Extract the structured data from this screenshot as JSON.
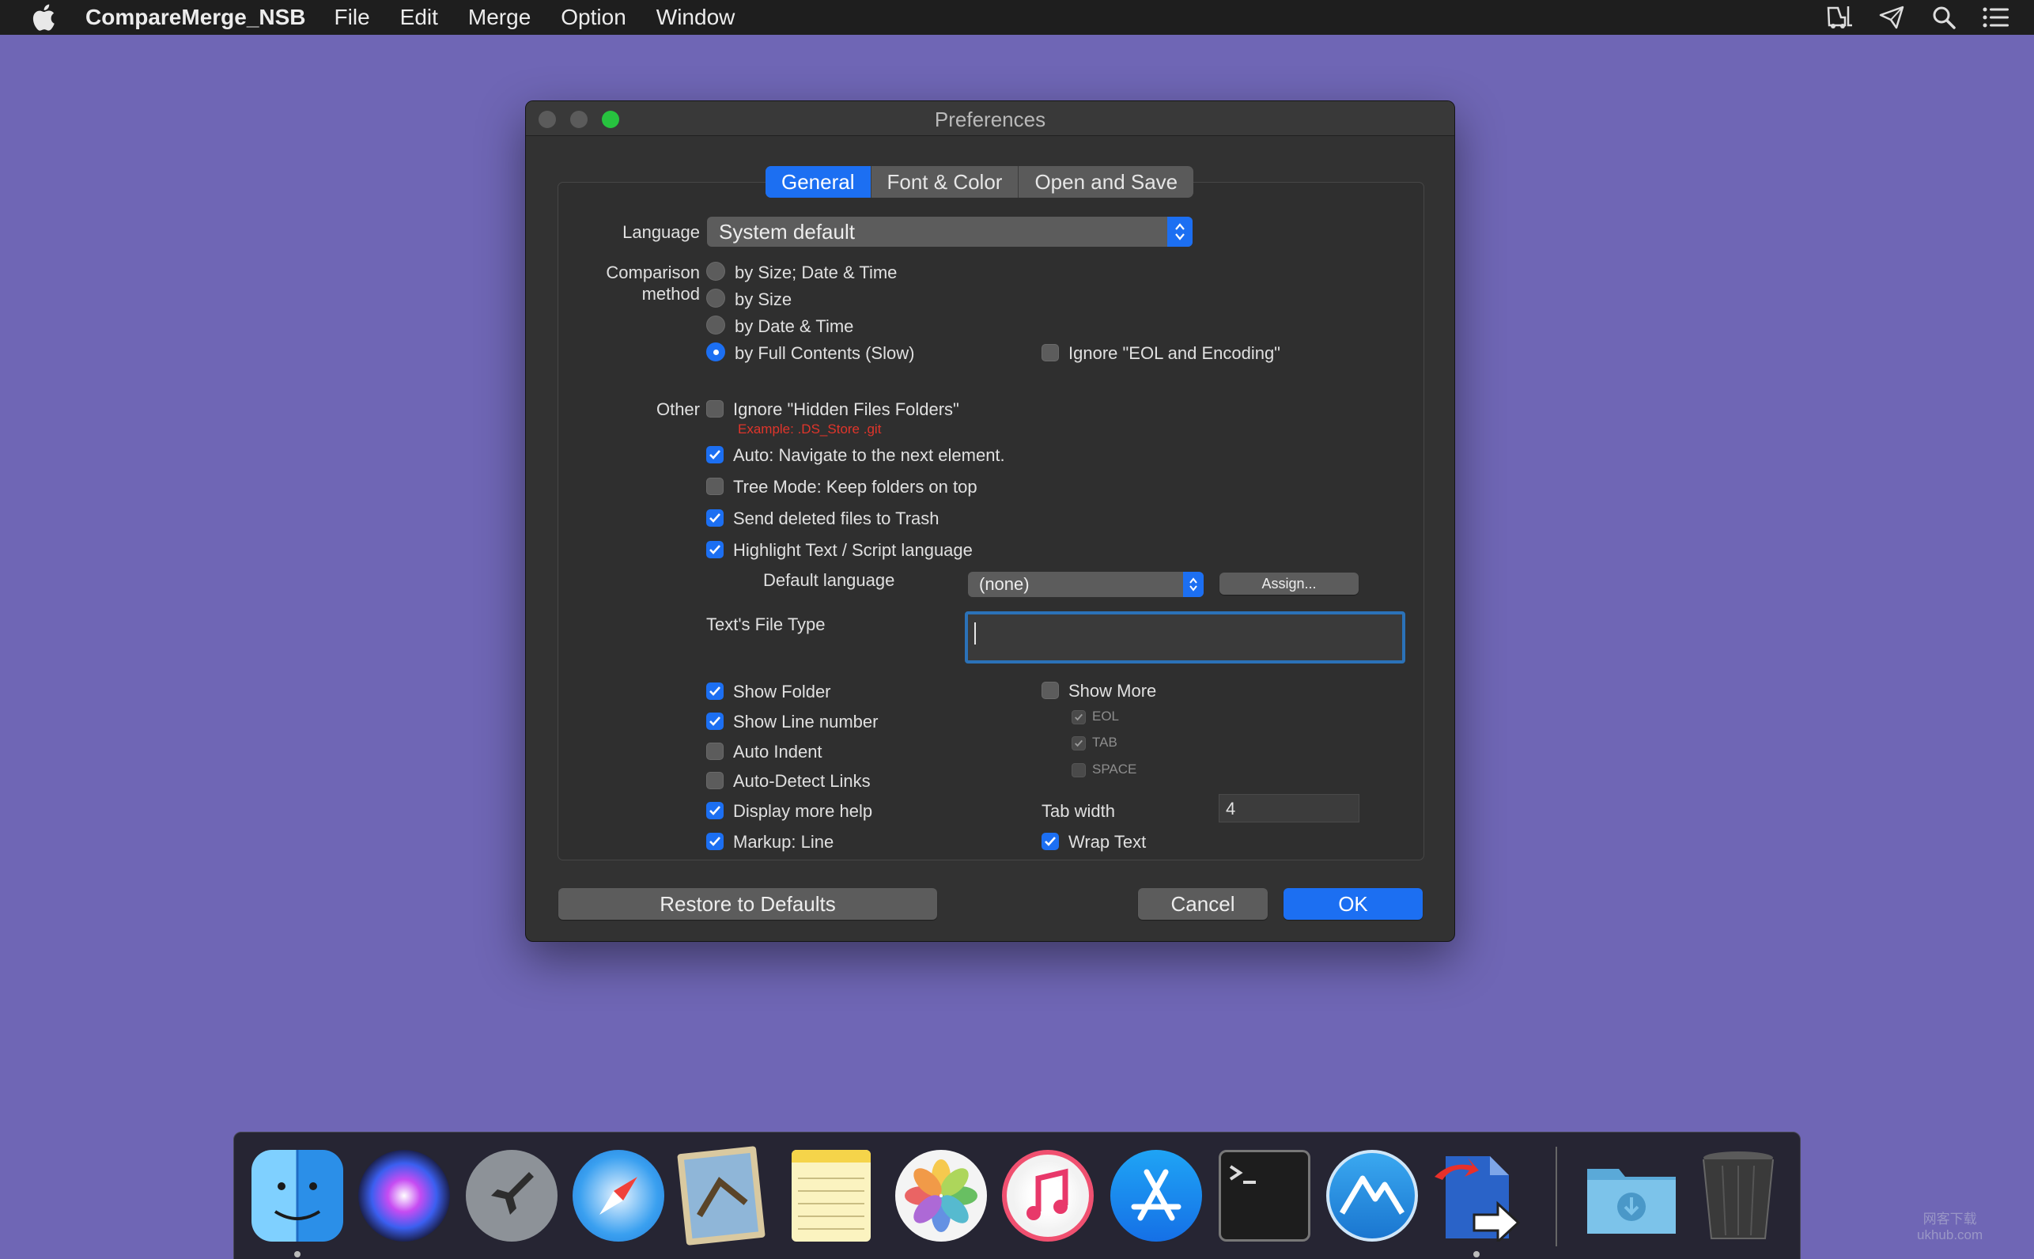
{
  "menubar": {
    "app_name": "CompareMerge_NSB",
    "items": [
      "File",
      "Edit",
      "Merge",
      "Option",
      "Window"
    ],
    "status_icons": [
      "forklift-icon",
      "send-icon",
      "spotlight-search-icon",
      "notification-center-icon"
    ]
  },
  "window": {
    "title": "Preferences",
    "tabs": [
      "General",
      "Font & Color",
      "Open and Save"
    ],
    "active_tab": "General"
  },
  "general": {
    "language_label": "Language",
    "language_value": "System default",
    "comparison_label_1": "Comparison",
    "comparison_label_2": "method",
    "comparison_options": [
      "by Size; Date & Time",
      "by Size",
      "by Date & Time",
      "by Full Contents (Slow)"
    ],
    "comparison_selected": "by Full Contents (Slow)",
    "ignore_eol_label": "Ignore \"EOL and Encoding\"",
    "ignore_eol_checked": false,
    "other_label": "Other",
    "ignore_hidden_label": "Ignore \"Hidden Files Folders\"",
    "ignore_hidden_checked": false,
    "ignore_hidden_hint": "Example: .DS_Store .git",
    "auto_navigate_label": "Auto: Navigate to the next element.",
    "auto_navigate_checked": true,
    "tree_mode_label": "Tree Mode: Keep folders on top",
    "tree_mode_checked": false,
    "send_trash_label": "Send deleted files to Trash",
    "send_trash_checked": true,
    "highlight_label": "Highlight Text / Script language",
    "highlight_checked": true,
    "default_language_label": "Default language",
    "default_language_value": "(none)",
    "assign_label": "Assign...",
    "file_type_label": "Text's File Type",
    "file_type_value": "",
    "show_folder_label": "Show Folder",
    "show_folder_checked": true,
    "show_line_label": "Show Line number",
    "show_line_checked": true,
    "auto_indent_label": "Auto Indent",
    "auto_indent_checked": false,
    "auto_detect_label": "Auto-Detect Links",
    "auto_detect_checked": false,
    "display_help_label": "Display more help",
    "display_help_checked": true,
    "markup_label": "Markup: Line",
    "markup_checked": true,
    "show_more_label": "Show More",
    "show_more_checked": false,
    "eol_label": "EOL",
    "eol_checked": true,
    "tab_label": "TAB",
    "tab_checked": true,
    "space_label": "SPACE",
    "space_checked": false,
    "tab_width_label": "Tab width",
    "tab_width_value": "4",
    "wrap_text_label": "Wrap Text",
    "wrap_text_checked": true
  },
  "buttons": {
    "restore": "Restore to Defaults",
    "cancel": "Cancel",
    "ok": "OK"
  },
  "dock": {
    "apps": [
      "Finder",
      "Siri",
      "Launchpad",
      "Safari",
      "Mail",
      "Notes",
      "Photos",
      "iTunes",
      "App Store",
      "Terminal",
      "Mountain app",
      "CompareMerge",
      "Downloads",
      "Trash"
    ]
  },
  "watermark": {
    "line1": "网客下载",
    "line2": "ukhub.com"
  },
  "colors": {
    "desktop": "#6f66b5",
    "accent": "#1c6ff2",
    "window_bg": "#323232",
    "hint_red": "#e0352b"
  }
}
